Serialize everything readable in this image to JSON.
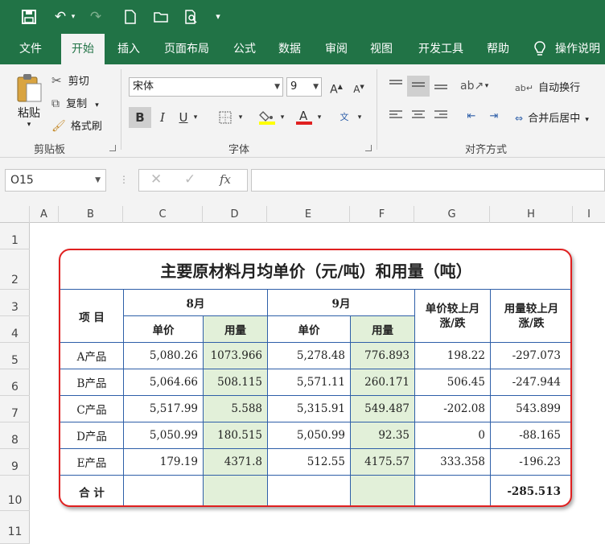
{
  "qat": {
    "more": "▾"
  },
  "tabs": [
    {
      "label": "文件"
    },
    {
      "label": "开始"
    },
    {
      "label": "插入"
    },
    {
      "label": "页面布局"
    },
    {
      "label": "公式"
    },
    {
      "label": "数据"
    },
    {
      "label": "审阅"
    },
    {
      "label": "视图"
    },
    {
      "label": "开发工具"
    },
    {
      "label": "帮助"
    },
    {
      "label": "操作说明"
    }
  ],
  "clipboard": {
    "paste": "粘贴",
    "cut": "剪切",
    "copy": "复制",
    "format_painter": "格式刷",
    "group": "剪贴板"
  },
  "font": {
    "name": "宋体",
    "size": "9",
    "bold": "B",
    "italic": "I",
    "underline": "U",
    "group": "字体",
    "font_color": "#e02020",
    "fill_color": "#ffff00"
  },
  "alignment": {
    "wrap": "自动换行",
    "merge": "合并后居中",
    "group": "对齐方式"
  },
  "namebox": "O15",
  "columns": [
    "A",
    "B",
    "C",
    "D",
    "E",
    "F",
    "G",
    "H",
    "I"
  ],
  "rows": [
    "1",
    "2",
    "3",
    "4",
    "5",
    "6",
    "7",
    "8",
    "9",
    "10",
    "11"
  ],
  "table": {
    "title": "主要原材料月均单价（元/吨）和用量（吨）",
    "item_header": "项  目",
    "month1": "8月",
    "month2": "9月",
    "price": "单价",
    "usage": "用量",
    "price_change": "单价较上月涨/跌",
    "usage_change": "用量较上月涨/跌",
    "rows": [
      {
        "name": "A产品",
        "p8": "5,080.26",
        "u8": "1073.966",
        "p9": "5,278.48",
        "u9": "776.893",
        "pc": "198.22",
        "uc": "-297.073"
      },
      {
        "name": "B产品",
        "p8": "5,064.66",
        "u8": "508.115",
        "p9": "5,571.11",
        "u9": "260.171",
        "pc": "506.45",
        "uc": "-247.944"
      },
      {
        "name": "C产品",
        "p8": "5,517.99",
        "u8": "5.588",
        "p9": "5,315.91",
        "u9": "549.487",
        "pc": "-202.08",
        "uc": "543.899"
      },
      {
        "name": "D产品",
        "p8": "5,050.99",
        "u8": "180.515",
        "p9": "5,050.99",
        "u9": "92.35",
        "pc": "0",
        "uc": "-88.165"
      },
      {
        "name": "E产品",
        "p8": "179.19",
        "u8": "4371.8",
        "p9": "512.55",
        "u9": "4175.57",
        "pc": "333.358",
        "uc": "-196.23"
      }
    ],
    "total_label": "合  计",
    "total_uc": "-285.513"
  }
}
